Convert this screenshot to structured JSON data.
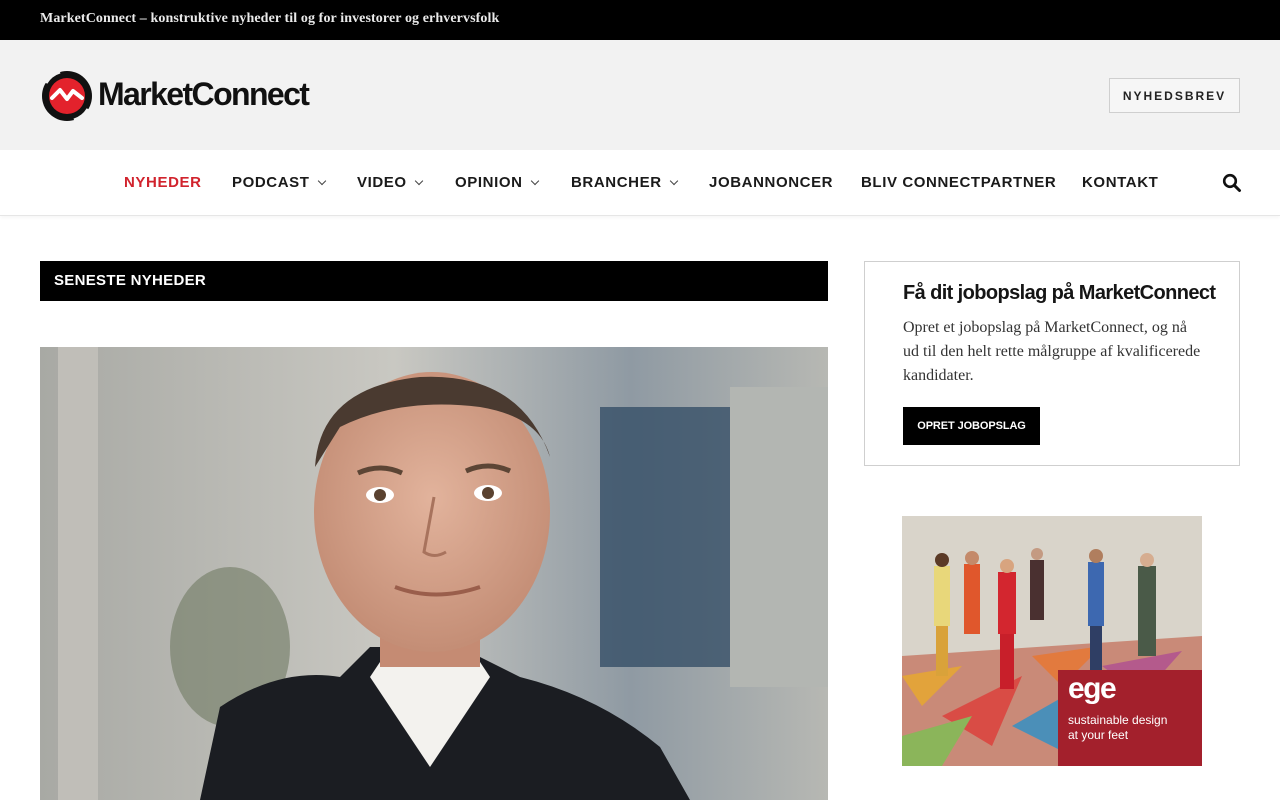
{
  "topbar": {
    "tagline": "MarketConnect – konstruktive nyheder til og for investorer og erhvervsfolk"
  },
  "header": {
    "logo_text": "MarketConnect",
    "newsletter_label": "NYHEDSBREV"
  },
  "nav": {
    "items": [
      {
        "label": "NYHEDER",
        "active": true,
        "dropdown": false
      },
      {
        "label": "PODCAST",
        "active": false,
        "dropdown": true
      },
      {
        "label": "VIDEO",
        "active": false,
        "dropdown": true
      },
      {
        "label": "OPINION",
        "active": false,
        "dropdown": true
      },
      {
        "label": "BRANCHER",
        "active": false,
        "dropdown": true
      },
      {
        "label": "JOBANNONCER",
        "active": false,
        "dropdown": false
      },
      {
        "label": "BLIV CONNECTPARTNER",
        "active": false,
        "dropdown": false
      },
      {
        "label": "KONTAKT",
        "active": false,
        "dropdown": false
      }
    ],
    "search_icon": "search-icon"
  },
  "main": {
    "section_title": "SENESTE NYHEDER"
  },
  "sidebar": {
    "job_box": {
      "title": "Få dit jobopslag på MarketConnect",
      "text": "Opret et jobopslag på MarketConnect, og nå ud til den helt rette målgruppe af kvalificerede kandidater.",
      "button_label": "OPRET JOBOPSLAG"
    },
    "ad": {
      "logo": "ege",
      "tagline_1": "sustainable design",
      "tagline_2": "at your feet"
    }
  },
  "colors": {
    "accent_red": "#d1232d",
    "topbar_bg": "#000000",
    "masthead_bg": "#f2f2f2"
  }
}
